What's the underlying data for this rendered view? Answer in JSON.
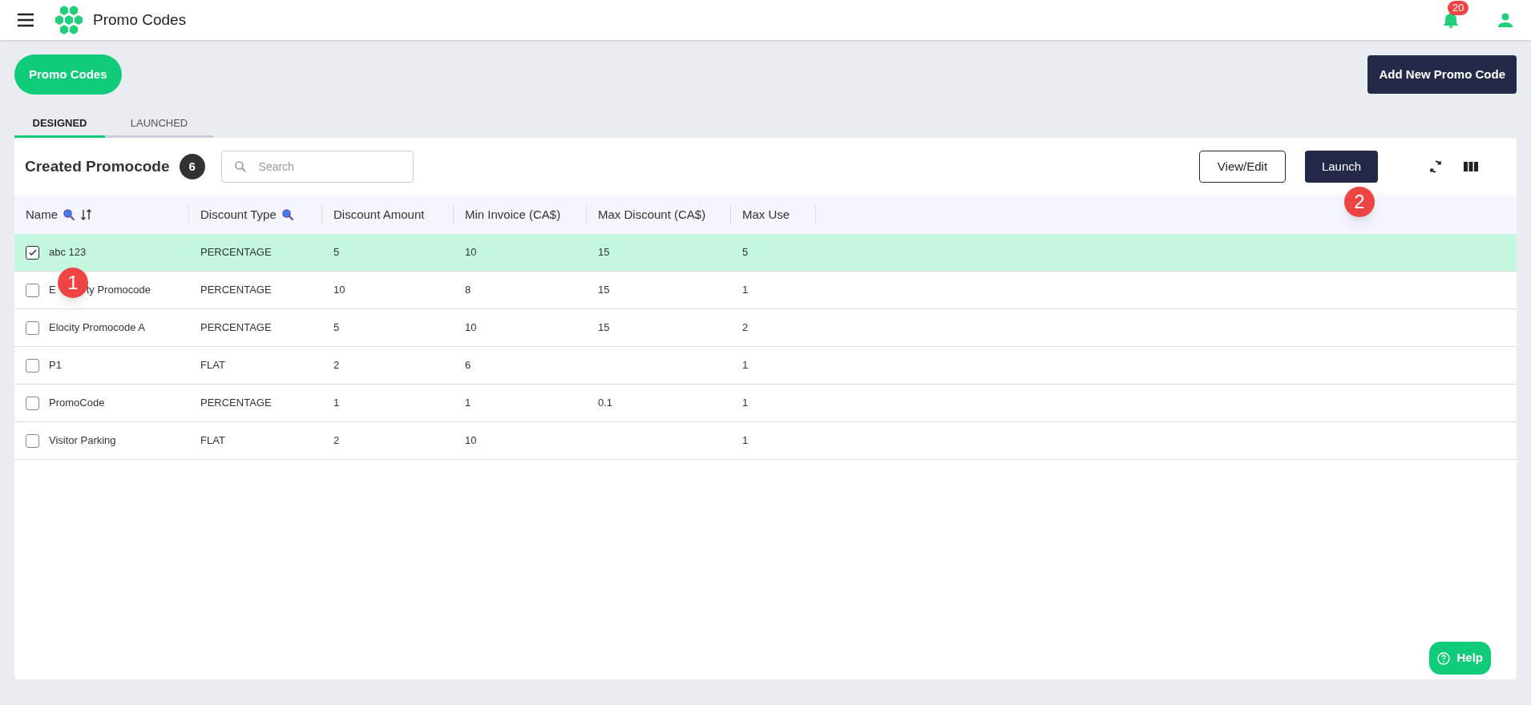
{
  "header": {
    "title": "Promo Codes",
    "notifications": "20"
  },
  "page_button": "Promo Codes",
  "add_button": "Add New Promo Code",
  "tabs": [
    {
      "label": "DESIGNED",
      "selected": true
    },
    {
      "label": "LAUNCHED",
      "selected": false
    }
  ],
  "card": {
    "title": "Created Promocode",
    "count": "6",
    "search": {
      "placeholder": "Search"
    },
    "buttons": [
      {
        "label": "View/Edit",
        "kind": "outline"
      },
      {
        "label": "Launch",
        "kind": "filled"
      }
    ]
  },
  "table": {
    "columns": [
      {
        "label": "Name",
        "search": true,
        "sort": true
      },
      {
        "label": "Discount Type",
        "search": true,
        "sort": false
      },
      {
        "label": "Discount Amount",
        "search": false,
        "sort": false
      },
      {
        "label": "Min Invoice (CA$)",
        "search": false,
        "sort": false
      },
      {
        "label": "Max Discount (CA$)",
        "search": false,
        "sort": false
      },
      {
        "label": "Max Use",
        "search": false,
        "sort": false
      }
    ],
    "rows": [
      {
        "selected": true,
        "cells": [
          "abc 123",
          "PERCENTAGE",
          "5",
          "10",
          "15",
          "5"
        ]
      },
      {
        "selected": false,
        "cells": [
          [
            "E",
            "ty Promocode"
          ],
          "PERCENTAGE",
          "10",
          "8",
          "15",
          "1"
        ]
      },
      {
        "selected": false,
        "cells": [
          "Elocity Promocode A",
          "PERCENTAGE",
          "5",
          "10",
          "15",
          "2"
        ]
      },
      {
        "selected": false,
        "cells": [
          "P1",
          "FLAT",
          "2",
          "6",
          "",
          "1"
        ]
      },
      {
        "selected": false,
        "cells": [
          "PromoCode",
          "PERCENTAGE",
          "1",
          "1",
          "0.1",
          "1"
        ]
      },
      {
        "selected": false,
        "cells": [
          "Visitor Parking",
          "FLAT",
          "2",
          "10",
          "",
          "1"
        ]
      }
    ]
  },
  "markers": [
    "1",
    "2"
  ],
  "help": "Help"
}
